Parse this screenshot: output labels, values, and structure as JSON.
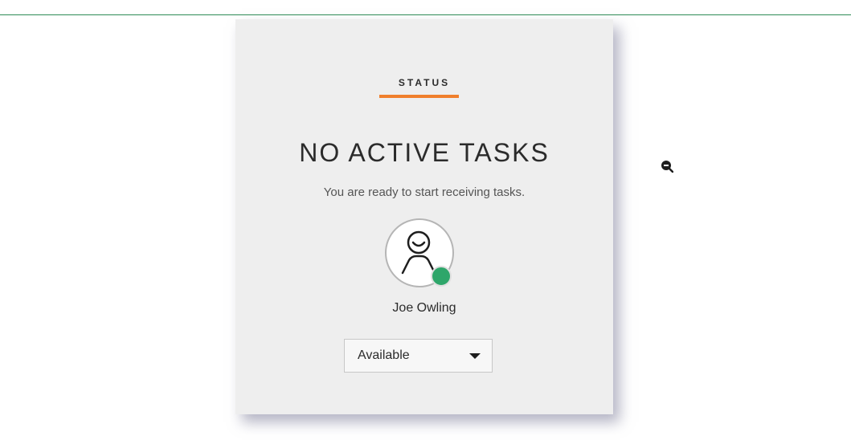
{
  "colors": {
    "top_rule": "#2e8b57",
    "accent": "#f07f2c",
    "presence_available": "#2ea66a"
  },
  "card": {
    "heading": "STATUS",
    "title": "NO ACTIVE TASKS",
    "subtitle": "You are ready to start receiving tasks.",
    "user": {
      "name": "Joe Owling",
      "avatar_icon": "user-outline-icon",
      "presence": "available"
    },
    "status_select": {
      "value": "Available",
      "icon": "caret-down-icon"
    }
  },
  "overlay": {
    "icon": "zoom-out-icon"
  }
}
